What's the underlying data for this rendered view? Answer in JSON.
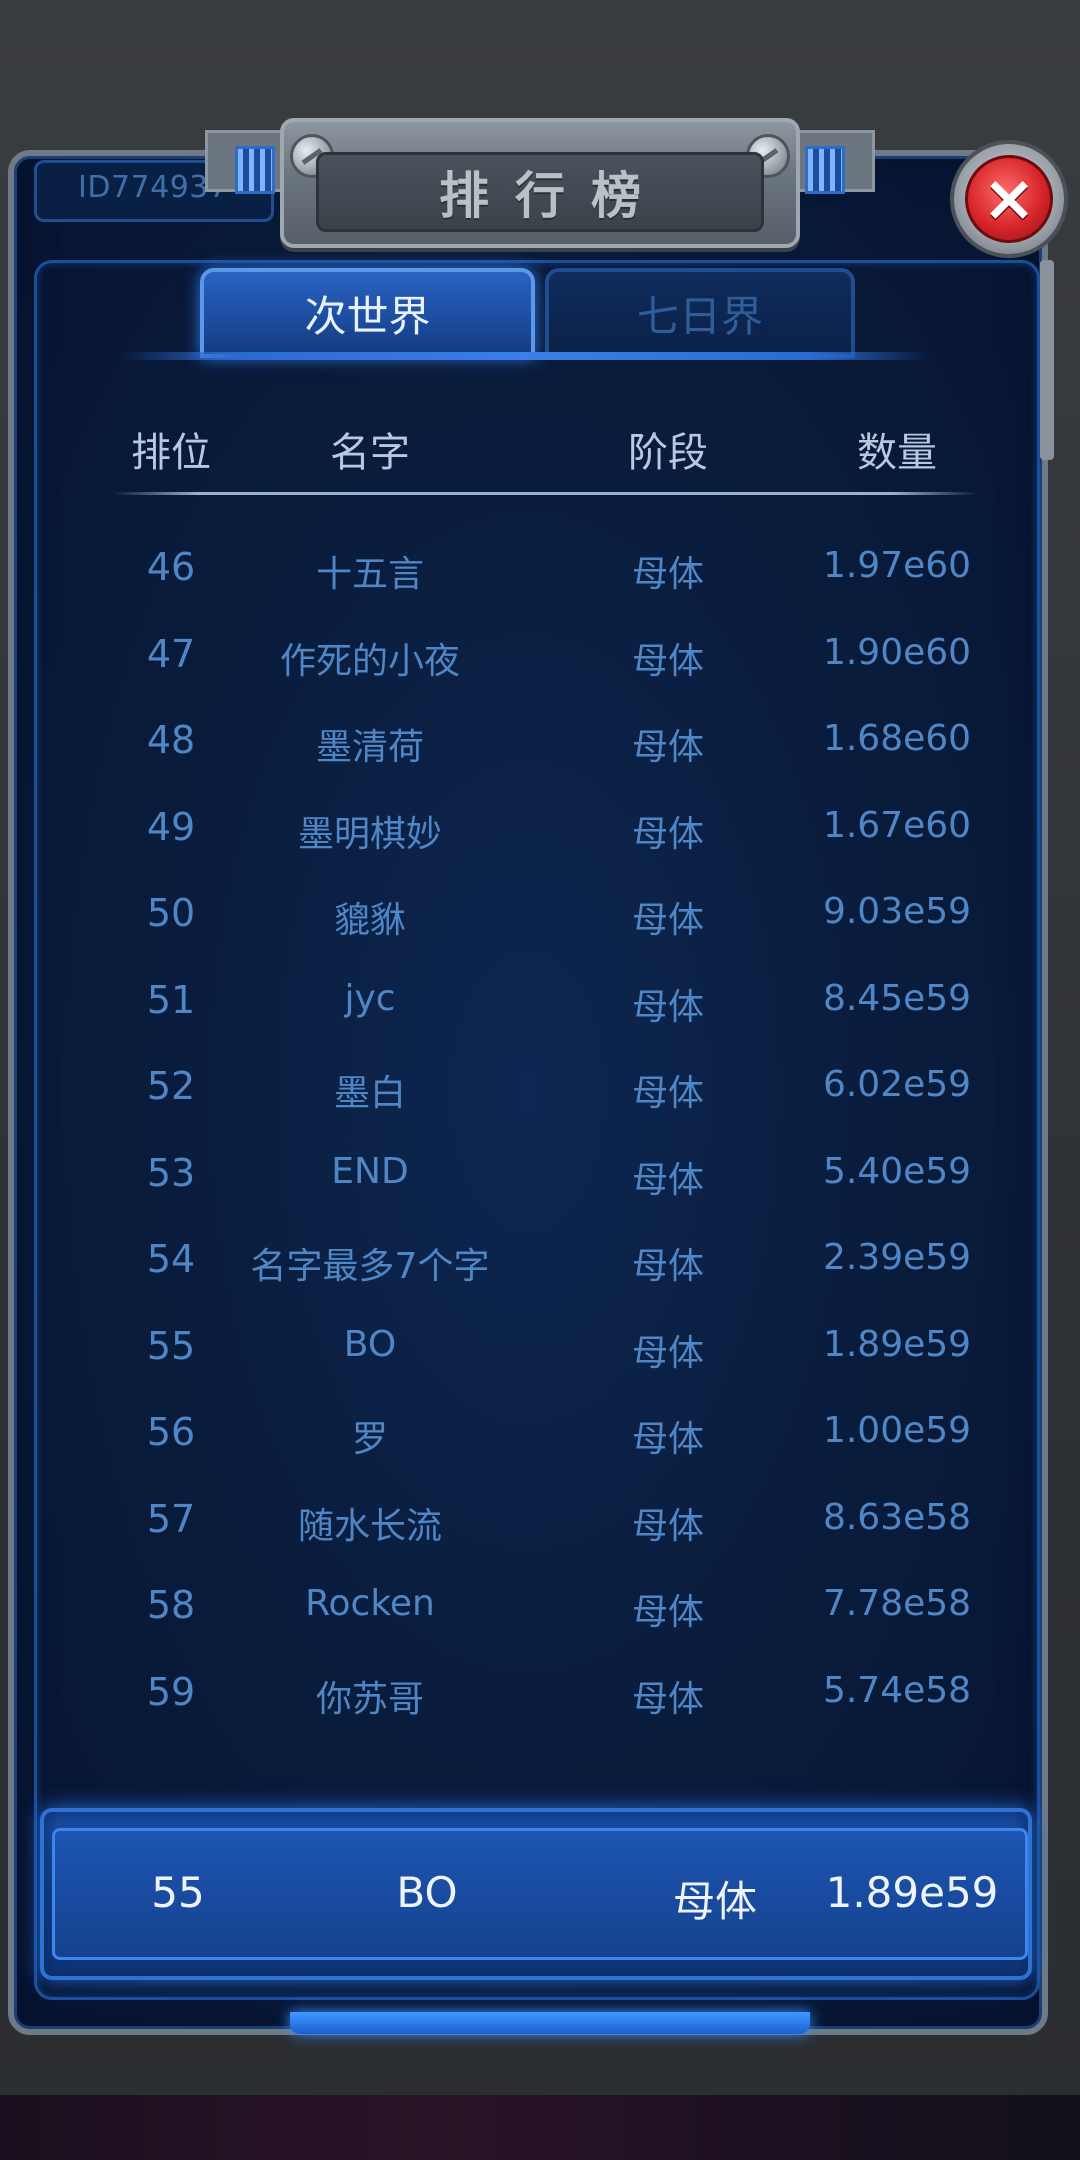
{
  "header": {
    "user_id": "ID774937",
    "title": "排行榜",
    "close_icon": "close-icon"
  },
  "tabs": [
    {
      "label": "次世界",
      "active": true
    },
    {
      "label": "七日界",
      "active": false
    }
  ],
  "table": {
    "columns": [
      "排位",
      "名字",
      "阶段",
      "数量"
    ],
    "rows": [
      {
        "rank": "46",
        "name": "十五言",
        "stage": "母体",
        "qty": "1.97e60"
      },
      {
        "rank": "47",
        "name": "作死的小夜",
        "stage": "母体",
        "qty": "1.90e60"
      },
      {
        "rank": "48",
        "name": "墨清荷",
        "stage": "母体",
        "qty": "1.68e60"
      },
      {
        "rank": "49",
        "name": "墨明棋妙",
        "stage": "母体",
        "qty": "1.67e60"
      },
      {
        "rank": "50",
        "name": "貔貅",
        "stage": "母体",
        "qty": "9.03e59"
      },
      {
        "rank": "51",
        "name": "jyc",
        "stage": "母体",
        "qty": "8.45e59"
      },
      {
        "rank": "52",
        "name": "墨白",
        "stage": "母体",
        "qty": "6.02e59"
      },
      {
        "rank": "53",
        "name": "END",
        "stage": "母体",
        "qty": "5.40e59"
      },
      {
        "rank": "54",
        "name": "名字最多7个字",
        "stage": "母体",
        "qty": "2.39e59"
      },
      {
        "rank": "55",
        "name": "BO",
        "stage": "母体",
        "qty": "1.89e59"
      },
      {
        "rank": "56",
        "name": "罗",
        "stage": "母体",
        "qty": "1.00e59"
      },
      {
        "rank": "57",
        "name": "随水长流",
        "stage": "母体",
        "qty": "8.63e58"
      },
      {
        "rank": "58",
        "name": "Rocken",
        "stage": "母体",
        "qty": "7.78e58"
      },
      {
        "rank": "59",
        "name": "你苏哥",
        "stage": "母体",
        "qty": "5.74e58"
      }
    ]
  },
  "my_entry": {
    "rank": "55",
    "name": "BO",
    "stage": "母体",
    "qty": "1.89e59"
  },
  "colors": {
    "panel_bg": "#0a1d3e",
    "accent_blue": "#2f72d6",
    "row_text": "#4f86c6",
    "close_red": "#d7262a"
  }
}
